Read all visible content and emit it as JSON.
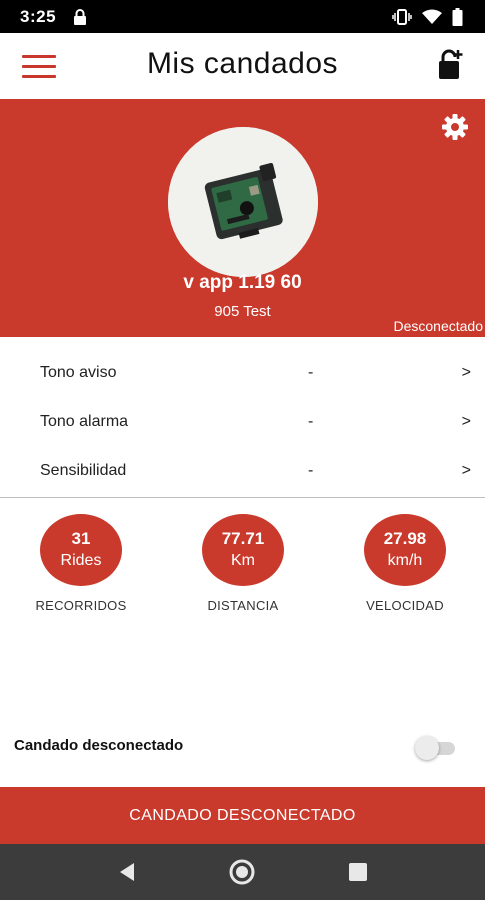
{
  "status_bar": {
    "time": "3:25"
  },
  "app_bar": {
    "title": "Mis candados"
  },
  "device": {
    "name": "v app 1.19 60",
    "id": "905 Test",
    "connection_status": "Desconectado"
  },
  "settings": [
    {
      "label": "Tono aviso",
      "value": "-",
      "arrow": ">"
    },
    {
      "label": "Tono alarma",
      "value": "-",
      "arrow": ">"
    },
    {
      "label": "Sensibilidad",
      "value": "-",
      "arrow": ">"
    }
  ],
  "stats": [
    {
      "value": "31",
      "unit": "Rides",
      "caption": "RECORRIDOS"
    },
    {
      "value": "77.71",
      "unit": "Km",
      "caption": "DISTANCIA"
    },
    {
      "value": "27.98",
      "unit": "km/h",
      "caption": "VELOCIDAD"
    }
  ],
  "toggle": {
    "label": "Candado desconectado",
    "on": false
  },
  "action": {
    "label": "CANDADO DESCONECTADO"
  },
  "colors": {
    "accent": "#c93a2c",
    "status_bar": "#000000",
    "nav_bar": "#3c3c3c"
  },
  "icons": [
    "lock-icon",
    "vibrate-icon",
    "wifi-icon",
    "battery-icon",
    "menu-icon",
    "add-lock-icon",
    "gear-icon",
    "back-icon",
    "home-icon",
    "recents-icon"
  ]
}
